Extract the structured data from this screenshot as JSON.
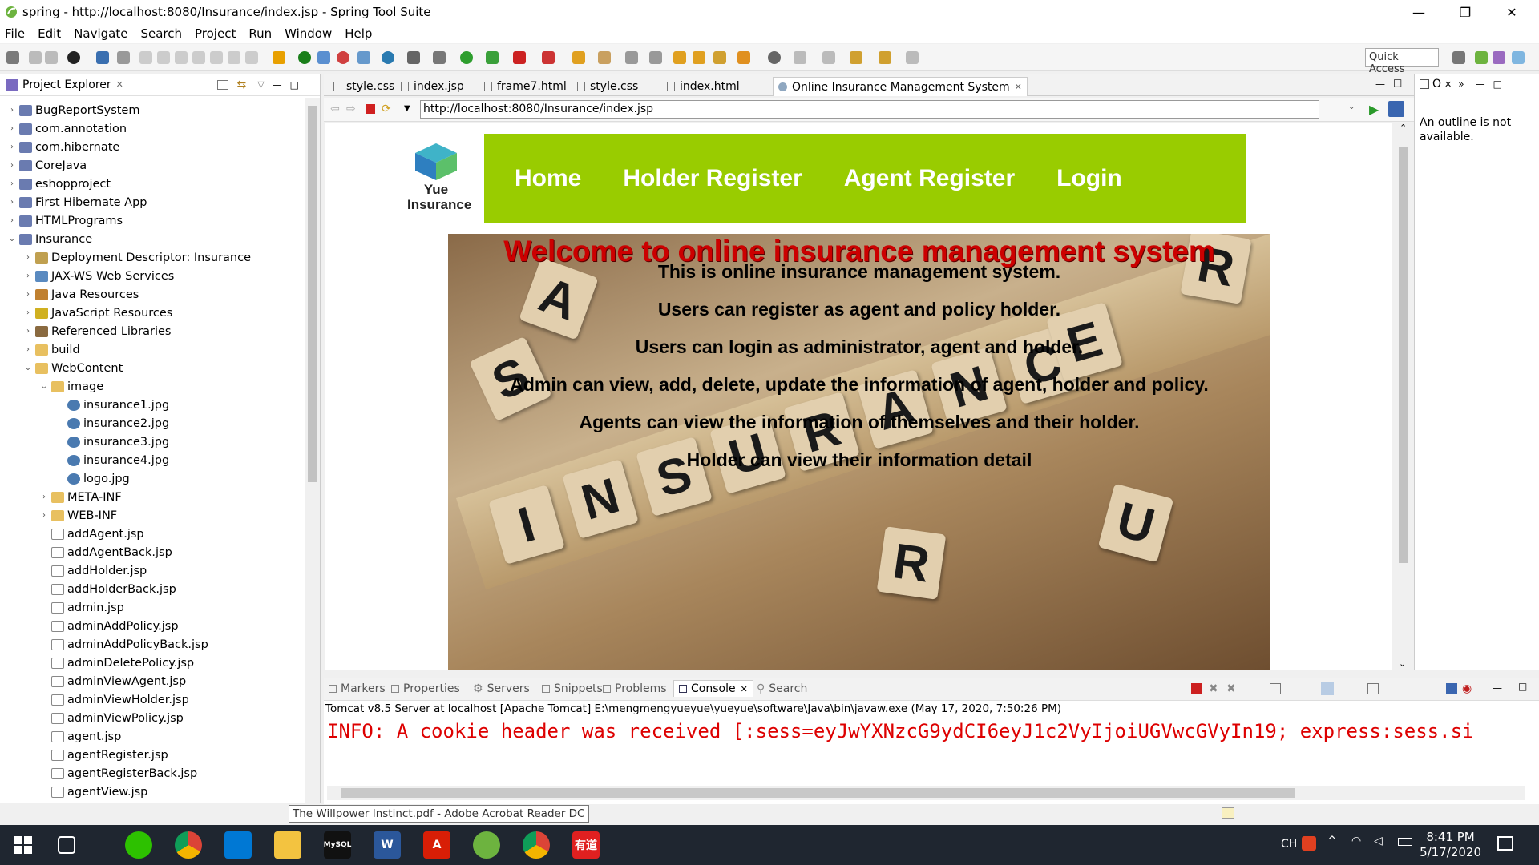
{
  "window": {
    "title": "spring - http://localhost:8080/Insurance/index.jsp - Spring Tool Suite"
  },
  "menu": [
    "File",
    "Edit",
    "Navigate",
    "Search",
    "Project",
    "Run",
    "Window",
    "Help"
  ],
  "toolbar": {
    "quick_access": "Quick Access"
  },
  "explorer": {
    "title": "Project Explorer",
    "items": [
      {
        "label": "BugReportSystem",
        "depth": 0,
        "arrow": "›",
        "icon": "project-icon"
      },
      {
        "label": "com.annotation",
        "depth": 0,
        "arrow": "›",
        "icon": "project-icon"
      },
      {
        "label": "com.hibernate",
        "depth": 0,
        "arrow": "›",
        "icon": "project-icon"
      },
      {
        "label": "CoreJava",
        "depth": 0,
        "arrow": "›",
        "icon": "project-icon"
      },
      {
        "label": "eshopproject",
        "depth": 0,
        "arrow": "›",
        "icon": "project-icon"
      },
      {
        "label": "First Hibernate App",
        "depth": 0,
        "arrow": "›",
        "icon": "project-icon"
      },
      {
        "label": "HTMLPrograms",
        "depth": 0,
        "arrow": "›",
        "icon": "project-icon"
      },
      {
        "label": "Insurance",
        "depth": 0,
        "arrow": "⌄",
        "icon": "project-icon"
      },
      {
        "label": "Deployment Descriptor: Insurance",
        "depth": 1,
        "arrow": "›",
        "icon": "descriptor-icon"
      },
      {
        "label": "JAX-WS Web Services",
        "depth": 1,
        "arrow": "›",
        "icon": "webservice-icon"
      },
      {
        "label": "Java Resources",
        "depth": 1,
        "arrow": "›",
        "icon": "java-resources-icon"
      },
      {
        "label": "JavaScript Resources",
        "depth": 1,
        "arrow": "›",
        "icon": "js-resources-icon"
      },
      {
        "label": "Referenced Libraries",
        "depth": 1,
        "arrow": "›",
        "icon": "library-icon"
      },
      {
        "label": "build",
        "depth": 1,
        "arrow": "›",
        "icon": "folder-icon"
      },
      {
        "label": "WebContent",
        "depth": 1,
        "arrow": "⌄",
        "icon": "folder-icon"
      },
      {
        "label": "image",
        "depth": 2,
        "arrow": "⌄",
        "icon": "folder-icon"
      },
      {
        "label": "insurance1.jpg",
        "depth": 3,
        "arrow": "",
        "icon": "image-file-icon"
      },
      {
        "label": "insurance2.jpg",
        "depth": 3,
        "arrow": "",
        "icon": "image-file-icon"
      },
      {
        "label": "insurance3.jpg",
        "depth": 3,
        "arrow": "",
        "icon": "image-file-icon"
      },
      {
        "label": "insurance4.jpg",
        "depth": 3,
        "arrow": "",
        "icon": "image-file-icon"
      },
      {
        "label": "logo.jpg",
        "depth": 3,
        "arrow": "",
        "icon": "image-file-icon"
      },
      {
        "label": "META-INF",
        "depth": 2,
        "arrow": "›",
        "icon": "folder-icon"
      },
      {
        "label": "WEB-INF",
        "depth": 2,
        "arrow": "›",
        "icon": "folder-icon"
      },
      {
        "label": "addAgent.jsp",
        "depth": 2,
        "arrow": "",
        "icon": "jsp-file-icon"
      },
      {
        "label": "addAgentBack.jsp",
        "depth": 2,
        "arrow": "",
        "icon": "jsp-file-icon"
      },
      {
        "label": "addHolder.jsp",
        "depth": 2,
        "arrow": "",
        "icon": "jsp-file-icon"
      },
      {
        "label": "addHolderBack.jsp",
        "depth": 2,
        "arrow": "",
        "icon": "jsp-file-icon"
      },
      {
        "label": "admin.jsp",
        "depth": 2,
        "arrow": "",
        "icon": "jsp-file-icon"
      },
      {
        "label": "adminAddPolicy.jsp",
        "depth": 2,
        "arrow": "",
        "icon": "jsp-file-icon"
      },
      {
        "label": "adminAddPolicyBack.jsp",
        "depth": 2,
        "arrow": "",
        "icon": "jsp-file-icon"
      },
      {
        "label": "adminDeletePolicy.jsp",
        "depth": 2,
        "arrow": "",
        "icon": "jsp-file-icon"
      },
      {
        "label": "adminViewAgent.jsp",
        "depth": 2,
        "arrow": "",
        "icon": "jsp-file-icon"
      },
      {
        "label": "adminViewHolder.jsp",
        "depth": 2,
        "arrow": "",
        "icon": "jsp-file-icon"
      },
      {
        "label": "adminViewPolicy.jsp",
        "depth": 2,
        "arrow": "",
        "icon": "jsp-file-icon"
      },
      {
        "label": "agent.jsp",
        "depth": 2,
        "arrow": "",
        "icon": "jsp-file-icon"
      },
      {
        "label": "agentRegister.jsp",
        "depth": 2,
        "arrow": "",
        "icon": "jsp-file-icon"
      },
      {
        "label": "agentRegisterBack.jsp",
        "depth": 2,
        "arrow": "",
        "icon": "jsp-file-icon"
      },
      {
        "label": "agentView.jsp",
        "depth": 2,
        "arrow": "",
        "icon": "jsp-file-icon"
      }
    ]
  },
  "editor_tabs": [
    "style.css",
    "index.jsp",
    "frame7.html",
    "style.css",
    "index.html",
    "Online Insurance Management System"
  ],
  "browser": {
    "url": "http://localhost:8080/Insurance/index.jsp"
  },
  "webpage": {
    "logo_text": [
      "Yue",
      "Insurance"
    ],
    "nav": [
      "Home",
      "Holder Register",
      "Agent Register",
      "Login"
    ],
    "nav_color": "#99cc00",
    "welcome": "Welcome to online insurance management system",
    "lines": [
      "This is online insurance management system.",
      "Users can register as agent and policy holder.",
      "Users can login as administrator, agent and holder.",
      "Admin can view, add, delete, update the information of agent, holder and policy.",
      "Agents can view the information of themselves and their holder.",
      "Holder can view their information detail"
    ],
    "tiles": [
      "I",
      "N",
      "S",
      "U",
      "R",
      "A",
      "N",
      "C",
      "E",
      "R",
      "A",
      "S",
      "R",
      "U"
    ]
  },
  "outline": {
    "tab": "O",
    "message": "An outline is not available."
  },
  "bottom_panel": {
    "tabs": [
      "Markers",
      "Properties",
      "Servers",
      "Snippets",
      "Problems",
      "Console",
      "Search"
    ],
    "active_tab": "Console",
    "console_header": "Tomcat v8.5 Server at localhost [Apache Tomcat] E:\\mengmengyueyue\\yueyue\\software\\Java\\bin\\javaw.exe (May 17, 2020, 7:50:26 PM)",
    "console_line": "INFO: A cookie header was received [:sess=eyJwYXNzcG9ydCI6eyJ1c2VyIjoiUGVwcGVyIn19; express:sess.si"
  },
  "status": {
    "tooltip": "The Willpower Instinct.pdf - Adobe Acrobat Reader DC"
  },
  "taskbar": {
    "ime": "CH",
    "time": "8:41 PM",
    "date": "5/17/2020"
  }
}
